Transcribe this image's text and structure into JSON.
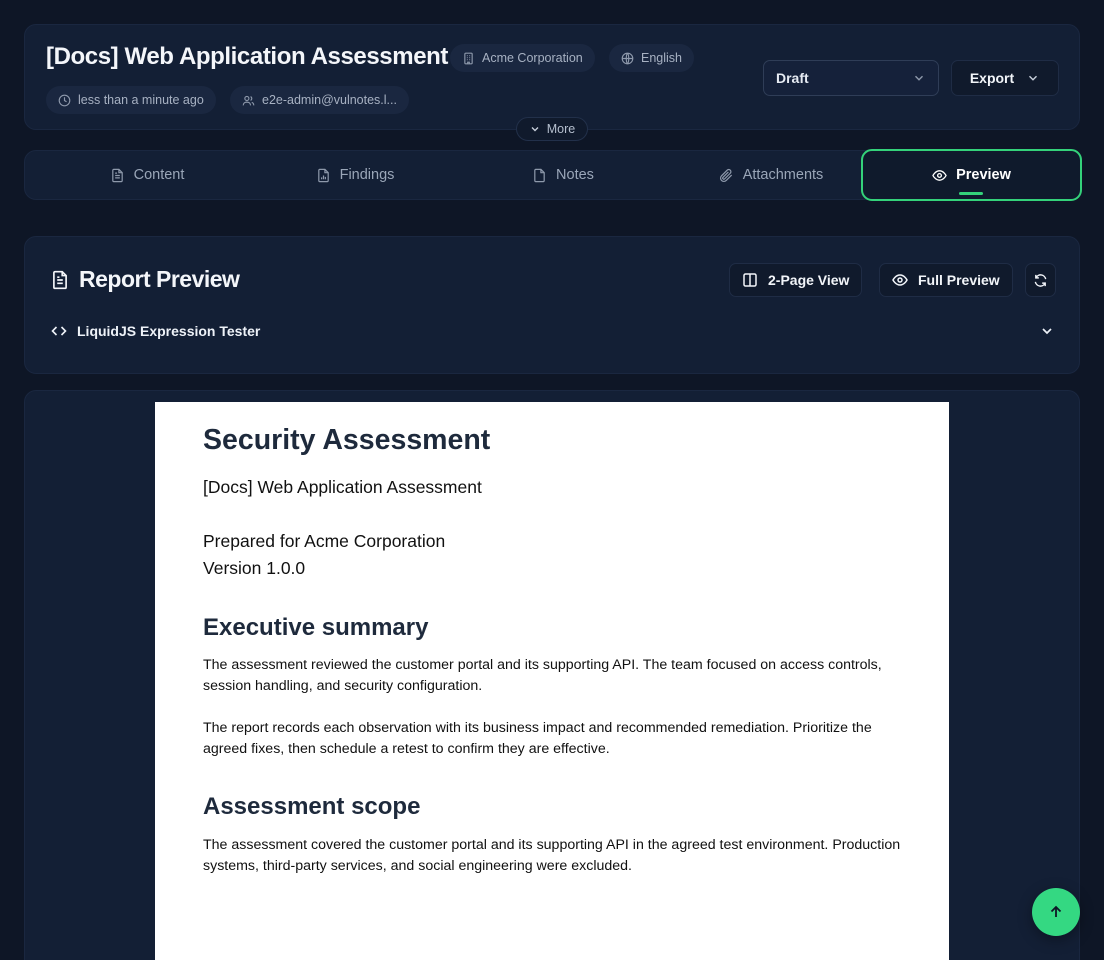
{
  "header": {
    "title": "[Docs] Web Application Assessment",
    "client": "Acme Corporation",
    "language": "English",
    "updated": "less than a minute ago",
    "assignee": "e2e-admin@vulnotes.l...",
    "status": "Draft",
    "export_label": "Export",
    "more_label": "More"
  },
  "tabs": [
    {
      "label": "Content",
      "icon": "file-text-icon"
    },
    {
      "label": "Findings",
      "icon": "file-chart-icon"
    },
    {
      "label": "Notes",
      "icon": "note-icon"
    },
    {
      "label": "Attachments",
      "icon": "paperclip-icon"
    },
    {
      "label": "Preview",
      "icon": "eye-icon",
      "active": true
    }
  ],
  "preview": {
    "title": "Report Preview",
    "two_page_label": "2-Page View",
    "full_preview_label": "Full Preview",
    "tester_label": "LiquidJS Expression Tester"
  },
  "document": {
    "heading": "Security Assessment",
    "subtitle": "[Docs] Web Application Assessment",
    "prepared_for": "Prepared for Acme Corporation",
    "version": "Version 1.0.0",
    "exec_summary_heading": "Executive summary",
    "exec_summary_p1": "The assessment reviewed the customer portal and its supporting API. The team focused on access controls, session handling, and security configuration.",
    "exec_summary_p2": "The report records each observation with its business impact and recommended remediation. Prioritize the agreed fixes, then schedule a retest to confirm they are effective.",
    "scope_heading": "Assessment scope",
    "scope_p1": "The assessment covered the customer portal and its supporting API in the agreed test environment. Production systems, third-party services, and social engineering were excluded."
  },
  "colors": {
    "background": "#0e1626",
    "card": "#131f35",
    "accent": "#34d27a",
    "fab": "#34d882"
  }
}
